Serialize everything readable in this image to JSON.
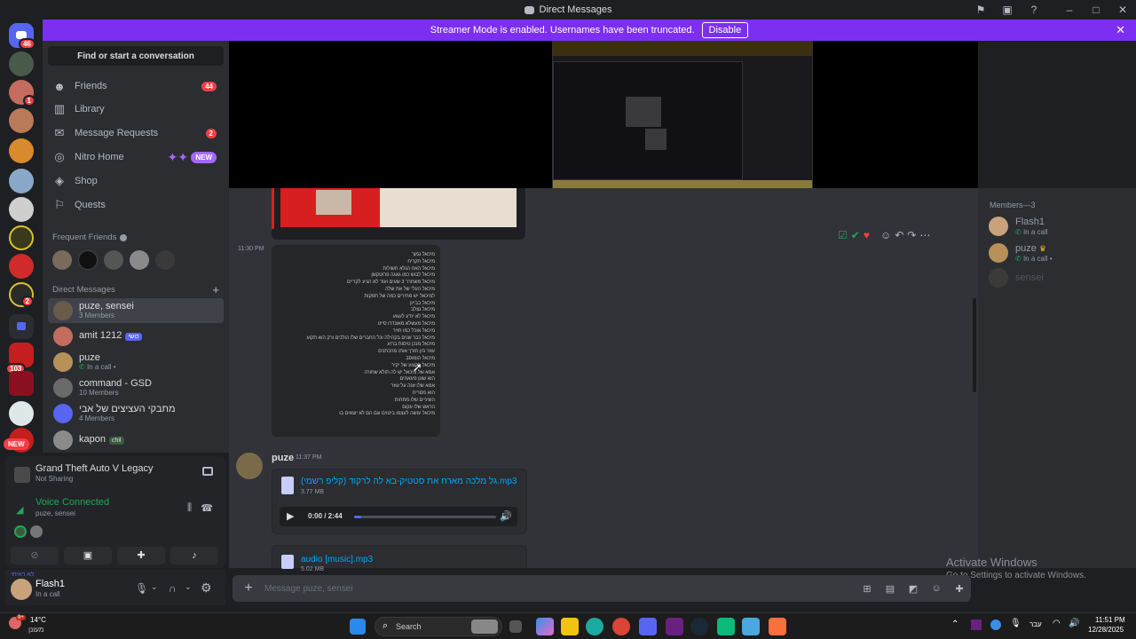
{
  "window": {
    "title": "Direct Messages"
  },
  "banner": {
    "text": "Streamer Mode is enabled. Usernames have been truncated.",
    "button": "Disable"
  },
  "servers": [
    {
      "badge": "46"
    },
    {
      "badge": ""
    },
    {
      "badge": "1"
    },
    {
      "badge": ""
    },
    {
      "badge": ""
    },
    {
      "badge": ""
    },
    {
      "badge": ""
    },
    {
      "badge": ""
    },
    {
      "badge": ""
    },
    {
      "badge": "2"
    },
    {
      "badge": ""
    },
    {
      "badge": "103"
    },
    {
      "badge": ""
    },
    {
      "badge": ""
    },
    {
      "badge": "NEW"
    }
  ],
  "sidebar": {
    "find_label": "Find or start a conversation",
    "nav": [
      {
        "label": "Friends",
        "count": "44"
      },
      {
        "label": "Library",
        "count": ""
      },
      {
        "label": "Message Requests",
        "count": "2"
      },
      {
        "label": "Nitro Home",
        "new": "NEW"
      },
      {
        "label": "Shop",
        "count": ""
      },
      {
        "label": "Quests",
        "count": ""
      }
    ],
    "frequent_friends_label": "Frequent Friends",
    "direct_messages_label": "Direct Messages",
    "dms": [
      {
        "name": "puze, sensei",
        "sub": "3 Members"
      },
      {
        "name": "amit 1212",
        "sub": "",
        "tag": "כושי"
      },
      {
        "name": "puze",
        "sub": "In a call •"
      },
      {
        "name": "command - GSD",
        "sub": "10 Members"
      },
      {
        "name": "מתבקי העציצים של אבי",
        "sub": "4 Members"
      },
      {
        "name": "kapon",
        "sub": "",
        "tag": "chil"
      }
    ]
  },
  "panel": {
    "game_title": "Grand Theft Auto V Legacy",
    "game_sub": "Not Sharing",
    "voice_title": "Voice Connected",
    "voice_sub": "puze, sensei"
  },
  "user": {
    "name": "Flash1",
    "status": "In a call",
    "mini_label": "לא ראיתי"
  },
  "chat": {
    "message1": {
      "time": "11:30 PM",
      "lines": [
        "מיכאל נמוך",
        "מיכאל תקריח",
        "מיכאל האח הגלא חשולות",
        "מיכאל לבוש כמו גאגה פרוטקשן",
        "מיכאל משחרר 3 שעים ועוד לא הגיע לקריים",
        "מיכאל העלי של את שלה",
        "למיכאל יש מחירים כמה של תפקות",
        "מיכאל בבייון",
        "מיכאל נצלב",
        "מיכאל לא יודע לעגוע",
        "מיכאל מעשלא מאונדרו סייט",
        "מיכאל אוכל כמו חזיר",
        "מיכאל כבר שנים בקהילה וכל החברים שלו הולכים ורק הוא תקוע",
        "מיכאל מנכן טיסות ברוע",
        "עוזר ג'ון תורך אותו מהכתנים",
        "מיכאל הומוסב",
        "מיכאל בקצוע של יקיר",
        "אמא של מיכאל יש לה תולא שחורה",
        "הוא שונן פיגאחים",
        "אמא שלו זונה על עוזר",
        "הוא מסריח",
        "השיניים שלו מתחות",
        "הראש שלו עקום",
        "מיכאל עושה לעצמו ביטוים וגם הם לא יוצאים בו"
      ]
    },
    "message2": {
      "author": "puze",
      "time": "11:37 PM",
      "file1": {
        "name": "גל מלכה מארח את סטטיק-בא לה לרקוד (קליפ רשמי).mp3",
        "size": "3.77 MB",
        "time": "0:00 / 2:44"
      },
      "file2": {
        "name": "audio [music].mp3",
        "size": "5.02 MB"
      }
    },
    "composer_placeholder": "Message puze, sensei"
  },
  "members": {
    "header": "Members—3",
    "list": [
      {
        "name": "Flash1",
        "sub": "In a call"
      },
      {
        "name": "puze",
        "sub": "In a call •"
      },
      {
        "name": "sensei",
        "sub": ""
      }
    ]
  },
  "watermark": {
    "title": "Activate Windows",
    "sub": "Go to Settings to activate Windows."
  },
  "taskbar": {
    "temp": "14°C",
    "weather": "מעונן",
    "search": "Search",
    "lang": "עבר",
    "time": "11:51 PM",
    "date": "12/28/2025",
    "weather_badge": "9+"
  },
  "colors": {
    "accent": "#7c2ff0",
    "brand": "#5865f2",
    "danger": "#f23f43",
    "online": "#23a55a"
  }
}
